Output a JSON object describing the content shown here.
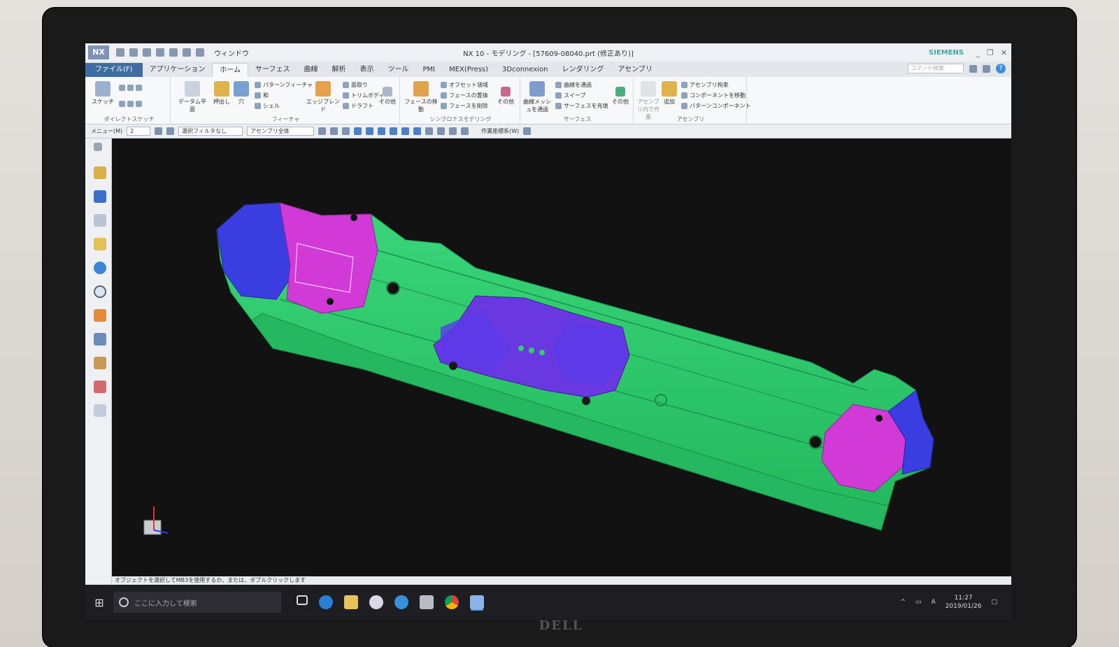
{
  "titlebar": {
    "logo": "NX",
    "window_menu": "ウィンドウ",
    "title": "NX 10 - モデリング - [57609-08040.prt (修正あり)]",
    "brand": "SIEMENS"
  },
  "tabs": [
    "ファイル(F)",
    "アプリケーション",
    "ホーム",
    "サーフェス",
    "曲線",
    "解析",
    "表示",
    "ツール",
    "PMI",
    "MEX(Press)",
    "3Dconnexion",
    "レンダリング",
    "アセンブリ"
  ],
  "active_tab": "ホーム",
  "search": {
    "placeholder": "コマンド検索"
  },
  "ribbon": {
    "sketch_group": {
      "label": "ダイレクトスケッチ",
      "sketch_button": "スケッチ"
    },
    "feature_group": {
      "label": "フィーチャ",
      "datum_plane": "データム平面",
      "extrude": "押出し",
      "hole": "穴",
      "pattern_feature": "パターンフィーチャ",
      "unite": "和",
      "shell": "シェル",
      "edge_blend": "エッジブレンド",
      "chamfer": "面取り",
      "trim_body": "トリムボディ",
      "draft": "ドラフト",
      "more": "その他"
    },
    "sync_group": {
      "label": "シンクロナスモデリング",
      "move_face": "フェースの移動",
      "offset_region": "オフセット領域",
      "replace_face": "フェースの置換",
      "delete_face": "フェースを削除",
      "more": "その他"
    },
    "surface_group": {
      "label": "サーフェス",
      "through_curve_mesh": "曲線メッシュを通過",
      "through_curves": "曲線を通過",
      "swept": "スイープ",
      "fill_surface": "サーフェスを充填",
      "more": "その他"
    },
    "assembly_group": {
      "label": "アセンブリ",
      "work_in_context": "アセンブリ内で作業",
      "add": "追加",
      "assembly_constraints": "アセンブリ拘束",
      "move_component": "コンポーネントを移動",
      "pattern_component": "パターンコンポーネント"
    }
  },
  "cmdbar": {
    "menu": "メニュー(M)",
    "level": "2",
    "selection_filter": "選択フィルタなし",
    "scope": "アセンブリ全体",
    "wcs": "作業座標系(W)"
  },
  "status": "オブジェクトを選択してMB3を使用するか、または、ダブルクリックします",
  "taskbar": {
    "search_placeholder": "ここに入力して検索",
    "ime": "A",
    "time": "11:27",
    "date": "2019/01/26"
  },
  "monitor_brand": "DELL",
  "colors": {
    "part_green": "#2fcf6f",
    "part_magenta": "#d23ad8",
    "part_blue": "#3a3de0",
    "viewport_bg": "#121212",
    "ribbon_accent": "#3f6da2"
  }
}
